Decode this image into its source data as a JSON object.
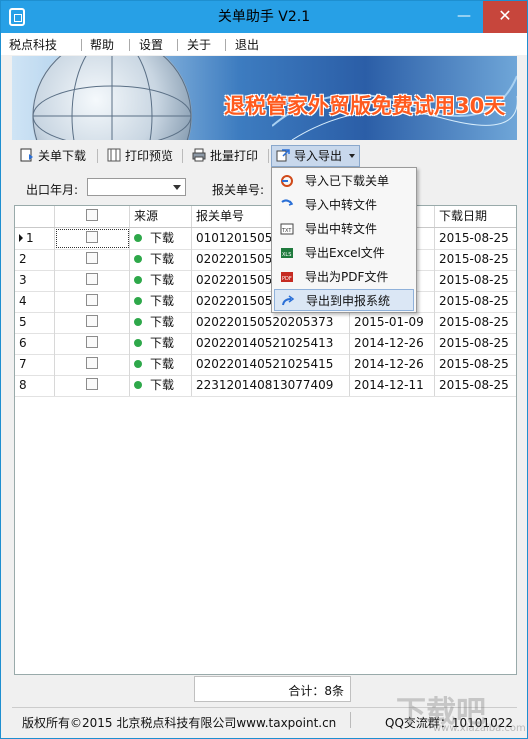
{
  "window": {
    "title": "关单助手  V2.1",
    "minimize": "—",
    "close": "✕"
  },
  "menu": [
    "税点科技",
    "帮助",
    "设置",
    "关于",
    "退出"
  ],
  "banner": {
    "slogan": "退税管家外贸版免费试用30天"
  },
  "toolbar": {
    "download": "关单下载",
    "preview": "打印预览",
    "batch_print": "批量打印",
    "import_export": "导入导出"
  },
  "filter": {
    "export_month_label": "出口年月:",
    "export_month_value": "",
    "customs_no_label": "报关单号:"
  },
  "grid": {
    "headers": [
      "",
      "",
      "来源",
      "报关单号",
      "",
      "下载日期"
    ],
    "rows": [
      {
        "num": "1",
        "source": "下载",
        "customs_no": "01012015051",
        "export_date": "",
        "download_date": "2015-08-25"
      },
      {
        "num": "2",
        "source": "下载",
        "customs_no": "02022015052",
        "export_date": "",
        "download_date": "2015-08-25"
      },
      {
        "num": "3",
        "source": "下载",
        "customs_no": "02022015052",
        "export_date": "",
        "download_date": "2015-08-25"
      },
      {
        "num": "4",
        "source": "下载",
        "customs_no": "02022015052",
        "export_date": "",
        "download_date": "2015-08-25"
      },
      {
        "num": "5",
        "source": "下载",
        "customs_no": "020220150520205373",
        "export_date": "2015-01-09",
        "download_date": "2015-08-25"
      },
      {
        "num": "6",
        "source": "下载",
        "customs_no": "020220140521025413",
        "export_date": "2014-12-26",
        "download_date": "2015-08-25"
      },
      {
        "num": "7",
        "source": "下载",
        "customs_no": "020220140521025415",
        "export_date": "2014-12-26",
        "download_date": "2015-08-25"
      },
      {
        "num": "8",
        "source": "下载",
        "customs_no": "223120140813077409",
        "export_date": "2014-12-11",
        "download_date": "2015-08-25"
      }
    ],
    "total": "合计：8条"
  },
  "dropdown": [
    "导入已下载关单",
    "导入中转文件",
    "导出中转文件",
    "导出Excel文件",
    "导出为PDF文件",
    "导出到申报系统"
  ],
  "status": {
    "copyright": "版权所有©2015 北京税点科技有限公司www.taxpoint.cn",
    "qq": "QQ交流群：10101022"
  },
  "watermark": {
    "text": "下载吧",
    "url": "www.xiazaiba.com"
  },
  "colors": {
    "titlebar": "#27a0e6",
    "close": "#c7463c",
    "banner_text": "#ff5a1e",
    "status_dot": "#2ea84a"
  }
}
